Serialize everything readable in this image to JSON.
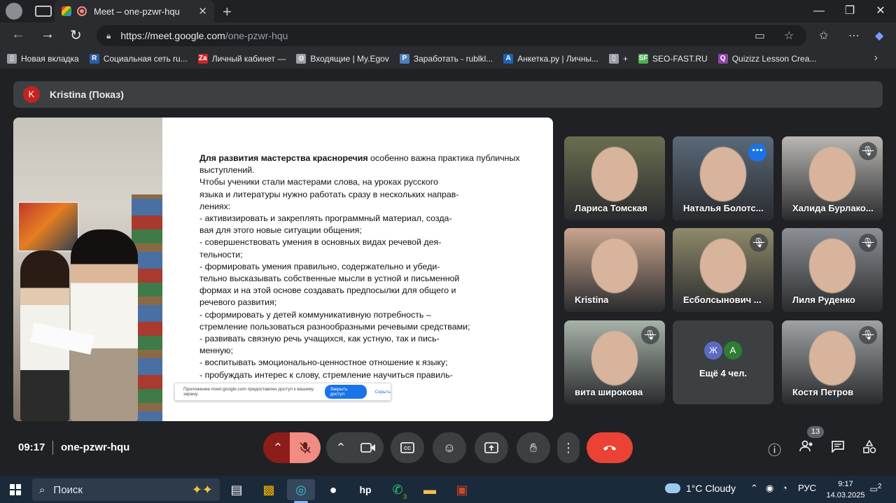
{
  "browser": {
    "tab_title": "Meet – one-pzwr-hqu",
    "url_host": "https://meet.google.com",
    "url_path": "/one-pzwr-hqu",
    "bookmarks": [
      {
        "label": "Новая вкладка",
        "icon": "page-icon",
        "color": "#9aa0a6"
      },
      {
        "label": "Социальная сеть ru...",
        "icon": "R",
        "color": "#2b5ea8"
      },
      {
        "label": "Личный кабинет —",
        "icon": "Za",
        "color": "#c62828"
      },
      {
        "label": "Входящие | My.Egov",
        "icon": "globe-icon",
        "color": "#9aa0a6"
      },
      {
        "label": "Заработать - rublkl...",
        "icon": "P",
        "color": "#4e7fbf"
      },
      {
        "label": "Анкетка.ру | Личны...",
        "icon": "A",
        "color": "#1e63b8"
      },
      {
        "label": "+",
        "icon": "page-icon",
        "color": "#9aa0a6"
      },
      {
        "label": "SEO-FAST.RU",
        "icon": "SF",
        "color": "#4caf50"
      },
      {
        "label": "Quizizz Lesson Crea...",
        "icon": "Q",
        "color": "#8e44ad"
      }
    ]
  },
  "meet": {
    "presenter_initial": "K",
    "presenter_label": "Kristina (Показ)",
    "slide": {
      "lines": [
        {
          "bold": "Для развития мастерства красноречия",
          "rest": " особенно важна практика публичных"
        },
        {
          "bold": "",
          "rest": "выступлений."
        },
        {
          "bold": "",
          "rest": "Чтобы ученики стали мастерами слова, на уроках русского"
        },
        {
          "bold": "",
          "rest": "языка и литературы нужно работать сразу в нескольких направ-"
        },
        {
          "bold": "",
          "rest": "лениях:"
        },
        {
          "bold": "",
          "rest": "- активизировать и закреплять программный материал, созда-"
        },
        {
          "bold": "",
          "rest": "вая для этого новые ситуации общения;"
        },
        {
          "bold": "",
          "rest": "- совершенствовать умения в основных видах речевой дея-"
        },
        {
          "bold": "",
          "rest": "тельности;"
        },
        {
          "bold": "",
          "rest": "- формировать умения правильно, содержательно и убеди-"
        },
        {
          "bold": "",
          "rest": "тельно высказывать собственные мысли в устной и письменной"
        },
        {
          "bold": "",
          "rest": "формах и на этой основе создавать предпосылки для общего и"
        },
        {
          "bold": "",
          "rest": "речевого развития;"
        },
        {
          "bold": "",
          "rest": "- сформировать у детей коммуникативную потребность –"
        },
        {
          "bold": "",
          "rest": "стремление пользоваться разнообразными речевыми средствами;"
        },
        {
          "bold": "",
          "rest": "- развивать связную речь учащихся, как устную, так и пись-"
        },
        {
          "bold": "",
          "rest": "менную;"
        },
        {
          "bold": "",
          "rest": "- воспитывать эмоционально-ценностное отношение к языку;"
        },
        {
          "bold": "",
          "rest": "- пробуждать интерес к слову, стремление научиться правиль-"
        }
      ],
      "share_notice": "Приложение meet.google.com предоставлен доступ к вашему экрану.",
      "stop_sharing": "Закрыть доступ",
      "hide": "Скрыть"
    },
    "participants": [
      {
        "name": "Лариса Томская",
        "muted": false,
        "bg": "#6b6f4f"
      },
      {
        "name": "Наталья Болотс...",
        "muted": false,
        "bg": "#5a6a7a",
        "active": true
      },
      {
        "name": "Халида Бурлако...",
        "muted": true,
        "bg": "#b9b7b2"
      },
      {
        "name": "Kristina",
        "muted": false,
        "bg": "#c9a58e"
      },
      {
        "name": "Есболсынович ...",
        "muted": true,
        "bg": "#8f8a6a"
      },
      {
        "name": "Лиля Руденко",
        "muted": true,
        "bg": "#8c8f94"
      },
      {
        "name": "вита широкова",
        "muted": true,
        "bg": "#a7b3a8"
      },
      {
        "name": "Костя Петров",
        "muted": true,
        "bg": "#9fa3a6"
      }
    ],
    "others": {
      "label": "Ещё 4 чел.",
      "avatars": [
        {
          "letter": "Ж",
          "color": "#5c6bc0"
        },
        {
          "letter": "А",
          "color": "#2e7d32"
        }
      ]
    },
    "time": "09:17",
    "meeting_code": "one-pzwr-hqu",
    "participants_count": "13"
  },
  "taskbar": {
    "search_placeholder": "Поиск",
    "whatsapp_count": "3",
    "weather": "1°C  Cloudy",
    "lang": "РУС",
    "clock_time": "9:17",
    "clock_date": "14.03.2025",
    "notifications": "2"
  }
}
